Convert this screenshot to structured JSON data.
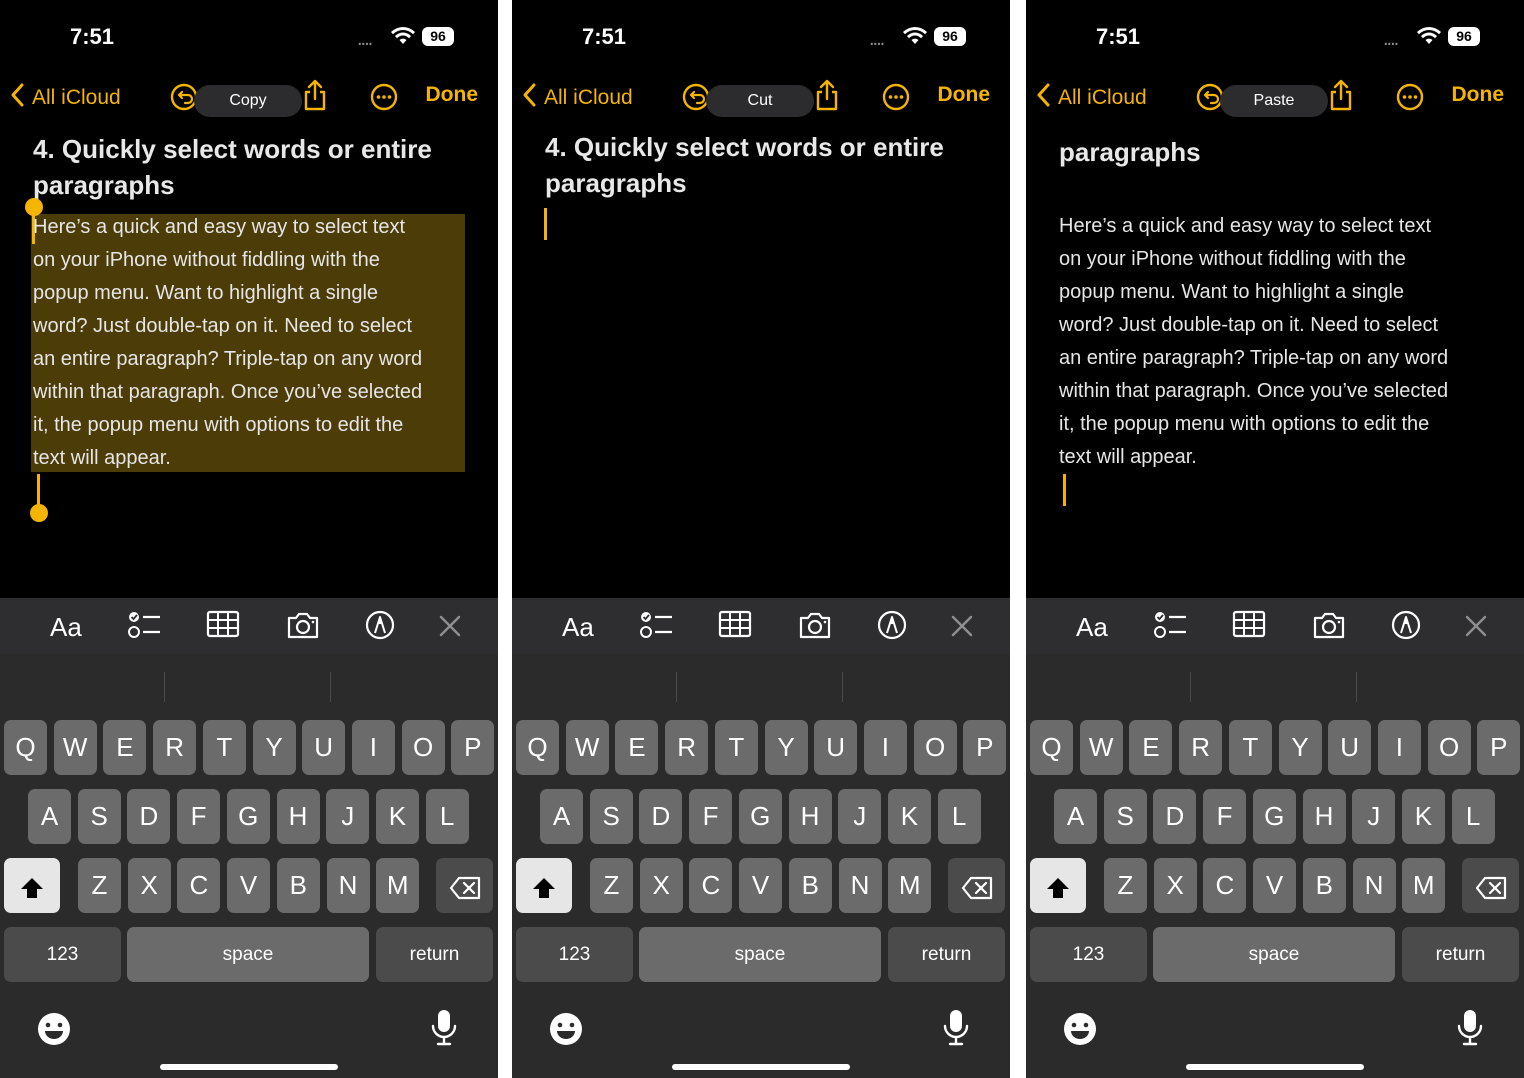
{
  "status": {
    "time": "7:51",
    "battery": "96",
    "dots": "....",
    "icons": [
      "wifi-icon"
    ]
  },
  "nav": {
    "back_label": "All iCloud",
    "done_label": "Done",
    "icons": [
      "back-chevron-icon",
      "undo-icon",
      "share-icon",
      "more-icon"
    ]
  },
  "panels": [
    {
      "menu": "Copy",
      "state": "text-selected"
    },
    {
      "menu": "Cut",
      "state": "text-removed"
    },
    {
      "menu": "Paste",
      "state": "text-pasted"
    }
  ],
  "note": {
    "heading": "4. Quickly select words or entire paragraphs",
    "heading_line1": "4. Quickly select words or entire",
    "heading_line2": "paragraphs",
    "body_lines": [
      "Here’s a quick and easy way to select text",
      "on your iPhone without fiddling with the",
      "popup menu. Want to highlight a single",
      "word? Just double-tap on it. Need to select",
      "an entire paragraph? Triple-tap on any word",
      "within that paragraph. Once you’ve selected",
      "it, the popup menu with options to edit the",
      "text will appear."
    ]
  },
  "toolbar": {
    "format_label": "Aa",
    "icons": [
      "checklist-icon",
      "table-icon",
      "camera-icon",
      "markup-icon",
      "close-icon"
    ]
  },
  "keyboard": {
    "row1": [
      "Q",
      "W",
      "E",
      "R",
      "T",
      "Y",
      "U",
      "I",
      "O",
      "P"
    ],
    "row2": [
      "A",
      "S",
      "D",
      "F",
      "G",
      "H",
      "J",
      "K",
      "L"
    ],
    "row3": [
      "Z",
      "X",
      "C",
      "V",
      "B",
      "N",
      "M"
    ],
    "numbers": "123",
    "space": "space",
    "return": "return",
    "icons": [
      "shift-icon",
      "delete-icon",
      "emoji-icon",
      "mic-icon"
    ]
  }
}
